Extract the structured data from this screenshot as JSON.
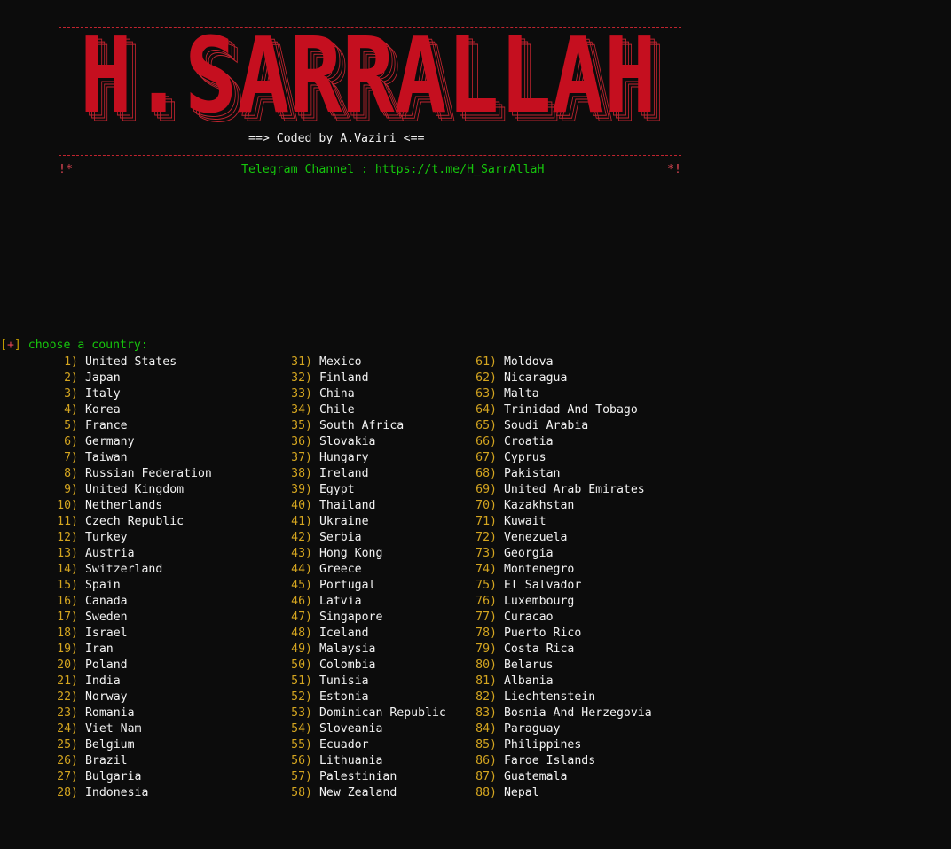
{
  "banner": {
    "logo_text": "H.SARRALLAH",
    "credit": "==> Coded by A.Vaziri <==",
    "bang_left": "!*",
    "bang_right": "*!",
    "telegram": "Telegram Channel : https://t.me/H_SarrAllaH"
  },
  "colors": {
    "background": "#0c0c0c",
    "banner_red": "#c50f1f",
    "prompt_green": "#16c60c",
    "number_yellow": "#d4a520",
    "text_white": "#f2f2f2"
  },
  "prompt": {
    "open": "[",
    "plus": "+",
    "close": "]",
    "text": " choose a country:"
  },
  "countries": {
    "col1": [
      {
        "n": "1)",
        "name": "United States"
      },
      {
        "n": "2)",
        "name": "Japan"
      },
      {
        "n": "3)",
        "name": "Italy"
      },
      {
        "n": "4)",
        "name": "Korea"
      },
      {
        "n": "5)",
        "name": "France"
      },
      {
        "n": "6)",
        "name": "Germany"
      },
      {
        "n": "7)",
        "name": "Taiwan"
      },
      {
        "n": "8)",
        "name": "Russian Federation"
      },
      {
        "n": "9)",
        "name": "United Kingdom"
      },
      {
        "n": "10)",
        "name": "Netherlands"
      },
      {
        "n": "11)",
        "name": "Czech Republic"
      },
      {
        "n": "12)",
        "name": "Turkey"
      },
      {
        "n": "13)",
        "name": "Austria"
      },
      {
        "n": "14)",
        "name": "Switzerland"
      },
      {
        "n": "15)",
        "name": "Spain"
      },
      {
        "n": "16)",
        "name": "Canada"
      },
      {
        "n": "17)",
        "name": "Sweden"
      },
      {
        "n": "18)",
        "name": "Israel"
      },
      {
        "n": "19)",
        "name": "Iran"
      },
      {
        "n": "20)",
        "name": "Poland"
      },
      {
        "n": "21)",
        "name": "India"
      },
      {
        "n": "22)",
        "name": "Norway"
      },
      {
        "n": "23)",
        "name": "Romania"
      },
      {
        "n": "24)",
        "name": "Viet Nam"
      },
      {
        "n": "25)",
        "name": "Belgium"
      },
      {
        "n": "26)",
        "name": "Brazil"
      },
      {
        "n": "27)",
        "name": "Bulgaria"
      },
      {
        "n": "28)",
        "name": "Indonesia"
      }
    ],
    "col2": [
      {
        "n": "31)",
        "name": "Mexico"
      },
      {
        "n": "32)",
        "name": "Finland"
      },
      {
        "n": "33)",
        "name": "China"
      },
      {
        "n": "34)",
        "name": "Chile"
      },
      {
        "n": "35)",
        "name": "South Africa"
      },
      {
        "n": "36)",
        "name": "Slovakia"
      },
      {
        "n": "37)",
        "name": "Hungary"
      },
      {
        "n": "38)",
        "name": "Ireland"
      },
      {
        "n": "39)",
        "name": "Egypt"
      },
      {
        "n": "40)",
        "name": "Thailand"
      },
      {
        "n": "41)",
        "name": "Ukraine"
      },
      {
        "n": "42)",
        "name": "Serbia"
      },
      {
        "n": "43)",
        "name": "Hong Kong"
      },
      {
        "n": "44)",
        "name": "Greece"
      },
      {
        "n": "45)",
        "name": "Portugal"
      },
      {
        "n": "46)",
        "name": "Latvia"
      },
      {
        "n": "47)",
        "name": "Singapore"
      },
      {
        "n": "48)",
        "name": "Iceland"
      },
      {
        "n": "49)",
        "name": "Malaysia"
      },
      {
        "n": "50)",
        "name": "Colombia"
      },
      {
        "n": "51)",
        "name": "Tunisia"
      },
      {
        "n": "52)",
        "name": "Estonia"
      },
      {
        "n": "53)",
        "name": "Dominican Republic"
      },
      {
        "n": "54)",
        "name": "Sloveania"
      },
      {
        "n": "55)",
        "name": "Ecuador"
      },
      {
        "n": "56)",
        "name": "Lithuania"
      },
      {
        "n": "57)",
        "name": "Palestinian"
      },
      {
        "n": "58)",
        "name": "New Zealand"
      }
    ],
    "col3": [
      {
        "n": "61)",
        "name": "Moldova"
      },
      {
        "n": "62)",
        "name": "Nicaragua"
      },
      {
        "n": "63)",
        "name": "Malta"
      },
      {
        "n": "64)",
        "name": "Trinidad And Tobago"
      },
      {
        "n": "65)",
        "name": "Soudi Arabia"
      },
      {
        "n": "66)",
        "name": "Croatia"
      },
      {
        "n": "67)",
        "name": "Cyprus"
      },
      {
        "n": "68)",
        "name": "Pakistan"
      },
      {
        "n": "69)",
        "name": "United Arab Emirates"
      },
      {
        "n": "70)",
        "name": "Kazakhstan"
      },
      {
        "n": "71)",
        "name": "Kuwait"
      },
      {
        "n": "72)",
        "name": "Venezuela"
      },
      {
        "n": "73)",
        "name": "Georgia"
      },
      {
        "n": "74)",
        "name": "Montenegro"
      },
      {
        "n": "75)",
        "name": "El Salvador"
      },
      {
        "n": "76)",
        "name": "Luxembourg"
      },
      {
        "n": "77)",
        "name": "Curacao"
      },
      {
        "n": "78)",
        "name": "Puerto Rico"
      },
      {
        "n": "79)",
        "name": "Costa Rica"
      },
      {
        "n": "80)",
        "name": "Belarus"
      },
      {
        "n": "81)",
        "name": "Albania"
      },
      {
        "n": "82)",
        "name": "Liechtenstein"
      },
      {
        "n": "83)",
        "name": "Bosnia And Herzegovia"
      },
      {
        "n": "84)",
        "name": "Paraguay"
      },
      {
        "n": "85)",
        "name": "Philippines"
      },
      {
        "n": "86)",
        "name": "Faroe Islands"
      },
      {
        "n": "87)",
        "name": "Guatemala"
      },
      {
        "n": "88)",
        "name": "Nepal"
      }
    ]
  }
}
